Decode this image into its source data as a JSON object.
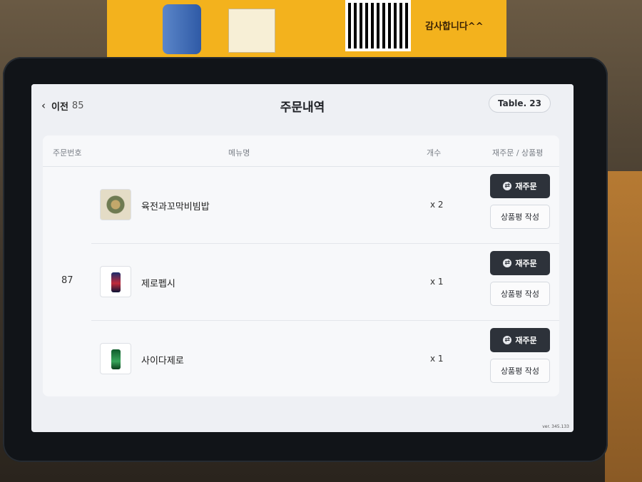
{
  "poster": {
    "thanks_text": "감사합니다^^"
  },
  "header": {
    "back_label": "이전",
    "back_count": "85",
    "title": "주문내역",
    "table_label": "Table. 23"
  },
  "columns": {
    "order_no": "주문번호",
    "menu": "메뉴명",
    "qty": "개수",
    "action": "재주문 / 상품평"
  },
  "order": {
    "number": "87",
    "items": [
      {
        "name": "육전과꼬막비빔밥",
        "qty": "x 2",
        "icon": "food-bowl-icon",
        "reorder": "재주문",
        "review": "상품평 작성"
      },
      {
        "name": "제로펩시",
        "qty": "x 1",
        "icon": "pepsi-bottle-icon",
        "reorder": "재주문",
        "review": "상품평 작성"
      },
      {
        "name": "사이다제로",
        "qty": "x 1",
        "icon": "cider-bottle-icon",
        "reorder": "재주문",
        "review": "상품평 작성"
      }
    ]
  },
  "footer": {
    "version": "ver. 345.133"
  },
  "colors": {
    "reorder_bg": "#2d323a",
    "screen_bg": "#eef0f4",
    "card_bg": "#f7f8fa"
  }
}
